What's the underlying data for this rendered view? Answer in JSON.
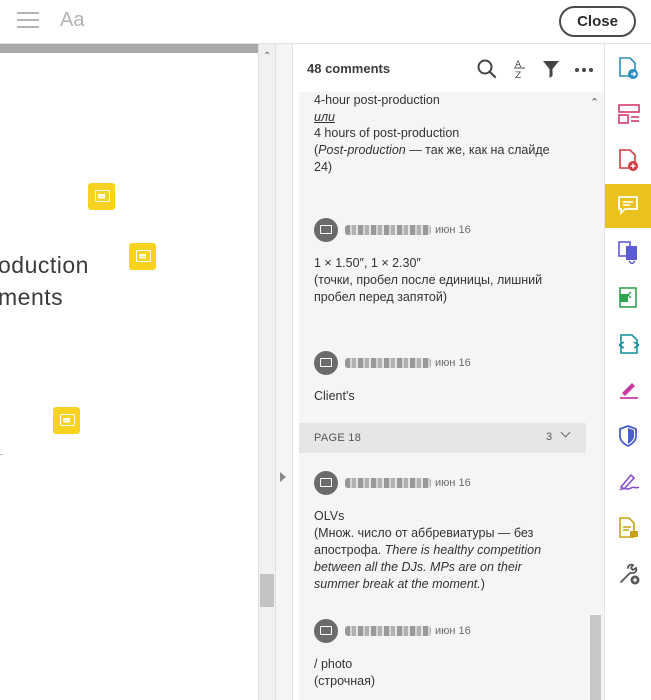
{
  "topbar": {
    "font_button": "Aa",
    "close_label": "Close"
  },
  "document": {
    "text_lines": [
      "oduction",
      "ments"
    ]
  },
  "comments_panel": {
    "count_label": "48 comments",
    "items": [
      {
        "lines": [
          "4-hour post-production",
          "или",
          "4 hours of post-production",
          "(Post-production — так же, как на слайде",
          "24)"
        ]
      },
      {
        "date": "июн 16",
        "lines": [
          "1 × 1.50″, 1 × 2.30″",
          "(точки, пробел после единицы, лишний",
          "пробел перед запятой)"
        ]
      },
      {
        "date": "июн 16",
        "lines": [
          "Client's"
        ]
      }
    ],
    "page_section": {
      "label": "PAGE 18",
      "count": "3"
    },
    "items_page18": [
      {
        "date": "июн 16",
        "lines": [
          "OLVs",
          "(Множ. число от аббревиатуры — без",
          "апострофа. There is healthy competition",
          "between all the DJs. MPs are on their",
          "summer break at the moment.)"
        ]
      },
      {
        "date": "июн 16",
        "lines": [
          "/ photo",
          "(строчная)"
        ]
      }
    ]
  },
  "colors": {
    "accent_active_tool": "#e9c21d",
    "note_yellow": "#f7d21e"
  },
  "tools": [
    "export-pdf-icon",
    "organize-pages-icon",
    "create-pdf-icon",
    "comment-icon",
    "combine-files-icon",
    "compress-pdf-icon",
    "edit-pdf-icon",
    "fill-sign-icon",
    "protect-icon",
    "request-signature-icon",
    "send-for-review-icon",
    "more-tools-icon"
  ]
}
